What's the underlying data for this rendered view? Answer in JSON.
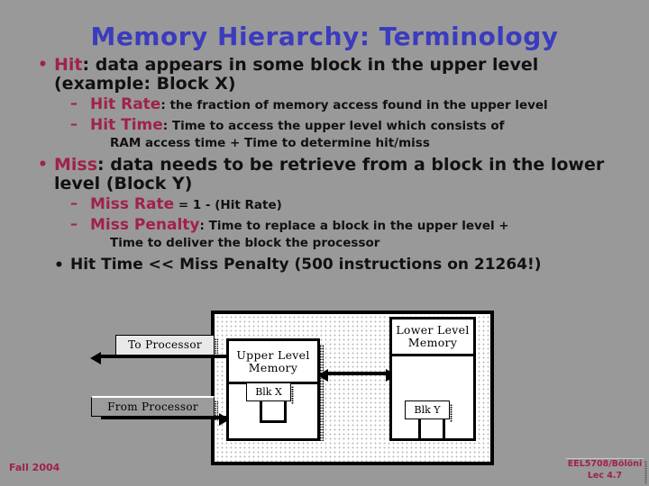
{
  "slide": {
    "title": "Memory Hierarchy: Terminology",
    "background_color": "#999999",
    "title_color": "#3b3bbf",
    "accent_color": "#a02249",
    "bullets": [
      {
        "marker": "•",
        "marker_color": "red",
        "key": "Hit",
        "key_suffix": ": ",
        "text": "data appears in some block in the upper level (example: Block X)",
        "subitems": [
          {
            "dash": "–",
            "key": "Hit Rate",
            "key_suffix": ": ",
            "text": "the fraction of memory access found in the upper level",
            "continuation": ""
          },
          {
            "dash": "–",
            "key": "Hit Time",
            "key_suffix": ": ",
            "text": "Time to access the upper level which consists of",
            "continuation": "RAM access time + Time to determine hit/miss"
          }
        ]
      },
      {
        "marker": "•",
        "marker_color": "red",
        "key": "Miss",
        "key_suffix": ": ",
        "text": "data needs to be retrieve from a block in the lower level (Block Y)",
        "subitems": [
          {
            "dash": "–",
            "key": "Miss Rate",
            "key_suffix": " ",
            "text": "= 1 - (Hit Rate)",
            "continuation": ""
          },
          {
            "dash": "–",
            "key": "Miss Penalty",
            "key_suffix": ": ",
            "text": "Time to replace a block in the upper level  +",
            "continuation": "Time to deliver the block the processor"
          }
        ]
      },
      {
        "marker": "•",
        "marker_color": "black",
        "key": "",
        "key_suffix": "",
        "text": "Hit  Time << Miss Penalty (500 instructions on 21264!)",
        "subitems": []
      }
    ]
  },
  "diagram": {
    "to_processor_label": "To Processor",
    "from_processor_label": "From Processor",
    "upper_level_label": "Upper Level Memory",
    "lower_level_label": "Lower Level Memory",
    "block_x_label": "Blk X",
    "block_y_label": "Blk Y"
  },
  "footer": {
    "left": "Fall 2004",
    "right_line1": "EEL5708/Bölöni",
    "right_line2": "Lec 4.7"
  }
}
